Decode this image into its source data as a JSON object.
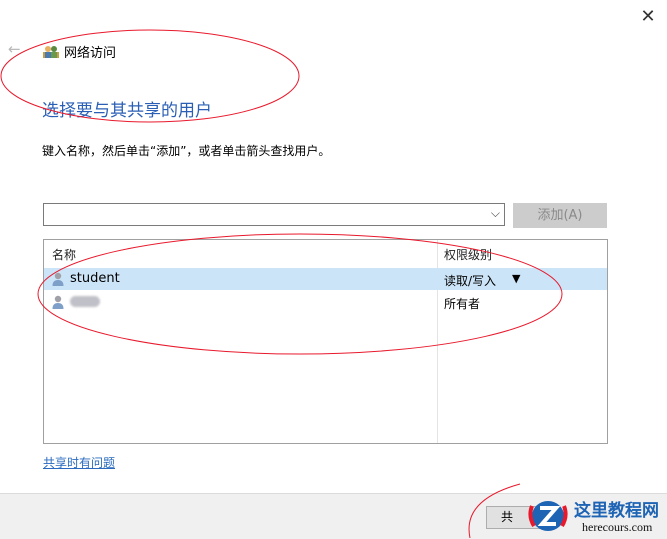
{
  "window": {
    "close_glyph": "✕",
    "back_glyph": "←"
  },
  "header": {
    "title": "网络访问",
    "heading": "选择要与其共享的用户"
  },
  "instruction": "键入名称，然后单击“添加”，或者单击箭头查找用户。",
  "add_form": {
    "input_value": "",
    "add_button": "添加(A)"
  },
  "user_list": {
    "columns": {
      "name": "名称",
      "permission": "权限级别"
    },
    "rows": [
      {
        "name": "student",
        "permission": "读取/写入",
        "selected": true
      },
      {
        "name": "",
        "name_obscured": true,
        "permission": "所有者",
        "selected": false
      }
    ]
  },
  "help_link": "共享时有问题",
  "footer": {
    "share_button": "共"
  },
  "watermark": {
    "brand": "这里教程网",
    "url": "herecours.com"
  },
  "colors": {
    "heading": "#2a5fb5",
    "selection": "#cce4f7",
    "link": "#2a6bbf",
    "annotation": "#e8192c"
  }
}
